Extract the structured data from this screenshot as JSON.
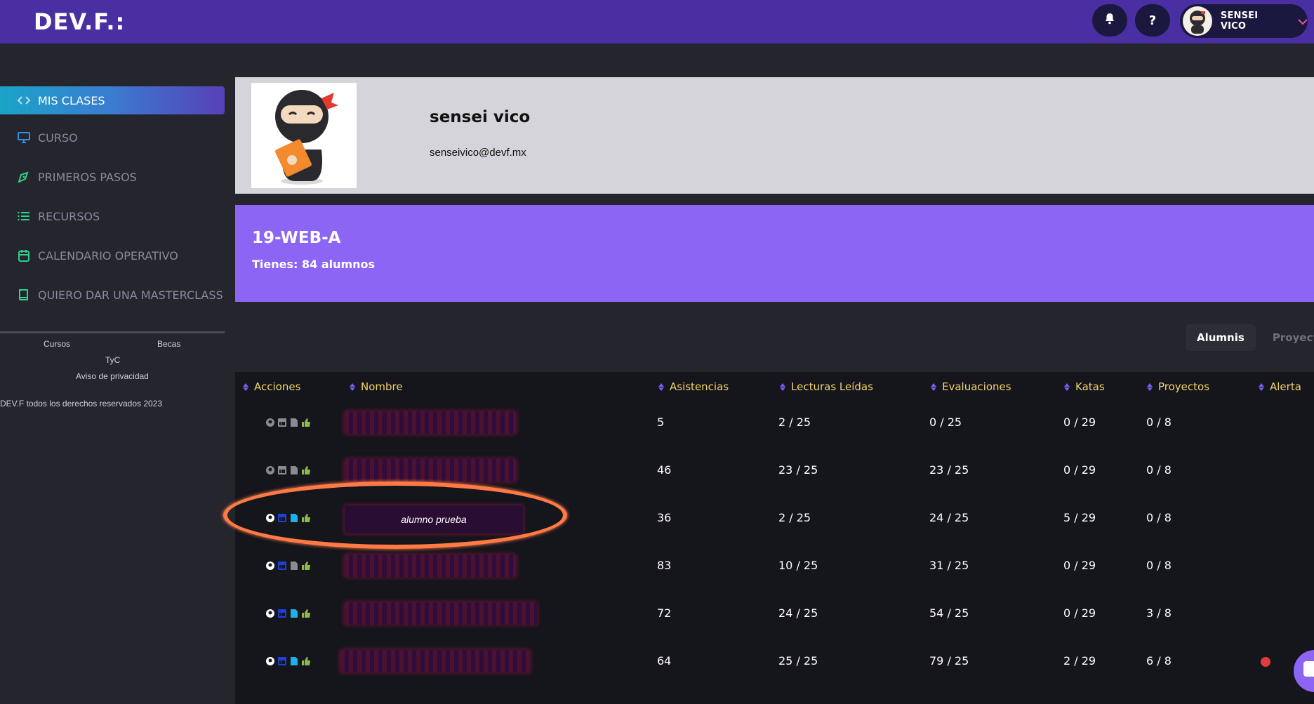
{
  "header": {
    "logo": "DEV.F.:",
    "user_name": "SENSEI VICO"
  },
  "sidebar": {
    "items": [
      {
        "label": "MIS CLASES",
        "icon": "code-brackets-icon",
        "active": true
      },
      {
        "label": "CURSO",
        "icon": "monitor-icon"
      },
      {
        "label": "PRIMEROS PASOS",
        "icon": "pen-tool-icon"
      },
      {
        "label": "RECURSOS",
        "icon": "list-icon"
      },
      {
        "label": "CALENDARIO OPERATIVO",
        "icon": "calendar-icon"
      },
      {
        "label": "QUIERO DAR UNA MASTERCLASS",
        "icon": "book-icon"
      }
    ],
    "footer_links": {
      "cursos": "Cursos",
      "becas": "Becas",
      "tyc": "TyC",
      "privacidad": "Aviso de privacidad"
    },
    "copyright": "DEV.F todos los derechos reservados 2023"
  },
  "profile": {
    "name": "sensei vico",
    "email": "senseivico@devf.mx"
  },
  "group": {
    "code": "19-WEB-A",
    "count_text": "Tienes: 84 alumnos"
  },
  "tabs": [
    "Alumnis",
    "Proyect"
  ],
  "table": {
    "columns": [
      "Acciones",
      "Nombre",
      "Asistencias",
      "Lecturas Leídas",
      "Evaluaciones",
      "Katas",
      "Proyectos",
      "Alerta"
    ],
    "rows": [
      {
        "name": "",
        "asistencias": "5",
        "lecturas": "2 / 25",
        "evaluaciones": "0 / 25",
        "katas": "0 / 29",
        "proyectos": "0 / 8",
        "alerta": false
      },
      {
        "name": "",
        "asistencias": "46",
        "lecturas": "23 / 25",
        "evaluaciones": "23 / 25",
        "katas": "0 / 29",
        "proyectos": "0 / 8",
        "alerta": false
      },
      {
        "name": "alumno prueba",
        "asistencias": "36",
        "lecturas": "2 / 25",
        "evaluaciones": "24 / 25",
        "katas": "5 / 29",
        "proyectos": "0 / 8",
        "alerta": false
      },
      {
        "name": "",
        "asistencias": "83",
        "lecturas": "10 / 25",
        "evaluaciones": "31 / 25",
        "katas": "0 / 29",
        "proyectos": "0 / 8",
        "alerta": false
      },
      {
        "name": "",
        "asistencias": "72",
        "lecturas": "24 / 25",
        "evaluaciones": "54 / 25",
        "katas": "0 / 29",
        "proyectos": "3 / 8",
        "alerta": false
      },
      {
        "name": "",
        "asistencias": "64",
        "lecturas": "25 / 25",
        "evaluaciones": "79 / 25",
        "katas": "2 / 29",
        "proyectos": "6 / 8",
        "alerta": true
      }
    ]
  },
  "colors": {
    "topbar": "#4a2fa3",
    "group_card": "#8c65f4",
    "header_text": "#f3d36a",
    "highlight": "#ff7a45",
    "alert": "#e23b3b"
  }
}
